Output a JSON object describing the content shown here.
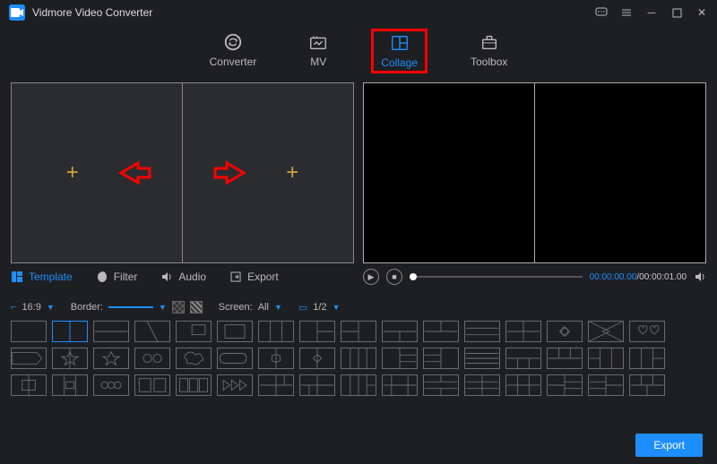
{
  "app": {
    "title": "Vidmore Video Converter"
  },
  "nav": {
    "converter": "Converter",
    "mv": "MV",
    "collage": "Collage",
    "toolbox": "Toolbox",
    "active": "collage"
  },
  "tabs": {
    "template": "Template",
    "filter": "Filter",
    "audio": "Audio",
    "export": "Export",
    "active": "template"
  },
  "player": {
    "current_time": "00:00:00.00",
    "total_time": "00:00:01.00"
  },
  "toolbar": {
    "ratio_label": "16:9",
    "border_label": "Border:",
    "screen_label": "Screen:",
    "screen_value": "All",
    "page_label": "1/2"
  },
  "footer": {
    "export": "Export"
  }
}
